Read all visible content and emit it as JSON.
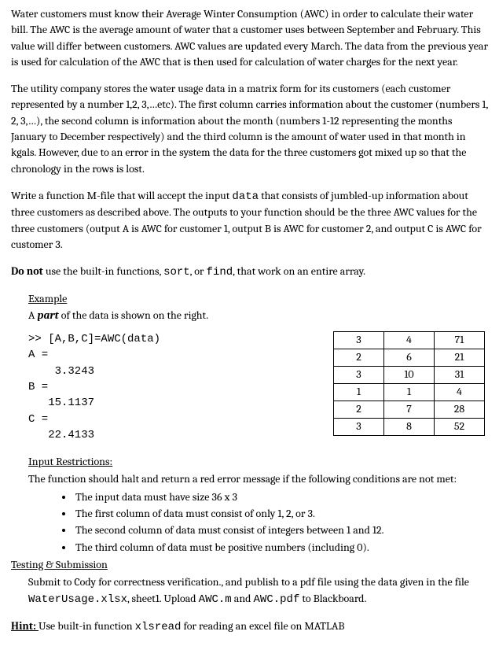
{
  "p1": "Water customers must know their Average Winter Consumption (AWC) in order to calculate their water bill. The AWC is the average amount of water that a customer uses between September and February. This value will differ between customers. AWC values are updated every March. The data from the previous year is used for calculation of the AWC that is then used for calculation of water charges for the next year.",
  "p2": "The utility company stores the water usage data in a matrix form for its customers (each customer represented by a number 1,2, 3,…etc). The first column carries information about the customer (numbers 1, 2, 3,…), the second column is information about the month (numbers 1-12 representing the months January to December respectively) and the third column is the amount of water used in that month in kgals. However, due to an error in the system the data for the three customers got mixed up so that the chronology in the rows is lost.",
  "p3_pre": "Write a function M-file that will accept the input ",
  "p3_code": "data",
  "p3_post": " that consists of jumbled-up information about three customers as described above. The outputs to your function should be the three AWC values for the three customers (output A is AWC for customer 1, output B is AWC for customer 2, and output C is AWC for customer 3.",
  "p4_strong": "Do not",
  "p4_mid1": " use the built-in functions, ",
  "p4_code1": "sort",
  "p4_mid2": ", or ",
  "p4_code2": "find",
  "p4_post": ", that work on an entire array.",
  "example_heading": "Example",
  "example_line_pre": "A ",
  "example_line_em": "part",
  "example_line_post": " of the data is shown on the right.",
  "code_output": ">> [A,B,C]=AWC(data)\nA =\n    3.3243\nB =\n   15.1137\nC =\n   22.4133",
  "table_rows": [
    [
      "3",
      "4",
      "71"
    ],
    [
      "2",
      "6",
      "21"
    ],
    [
      "3",
      "10",
      "31"
    ],
    [
      "1",
      "1",
      "4"
    ],
    [
      "2",
      "7",
      "28"
    ],
    [
      "3",
      "8",
      "52"
    ]
  ],
  "restrictions_heading": "Input Restrictions:",
  "restrictions_intro": "The function should halt and return a red error message if the following conditions are not met:",
  "restrictions": [
    "The input data must have size 36 x 3",
    "The first column of data must consist of only 1, 2, or 3.",
    "The second column of data must consist of integers between 1 and 12.",
    "The third column of data must be positive numbers (including 0)."
  ],
  "testing_heading": "Testing & Submission",
  "submit_pre": "Submit to Cody for correctness verification., and publish to a pdf file using the data given in the file ",
  "submit_file": "WaterUsage.xlsx",
  "submit_mid1": ", sheet1. Upload ",
  "submit_code1": "AWC.m",
  "submit_mid2": " and ",
  "submit_code2": "AWC.pdf",
  "submit_post": " to Blackboard.",
  "hint_label": "Hint: ",
  "hint_pre": "Use built-in function ",
  "hint_code": "xlsread",
  "hint_post": " for reading an excel file on MATLAB"
}
